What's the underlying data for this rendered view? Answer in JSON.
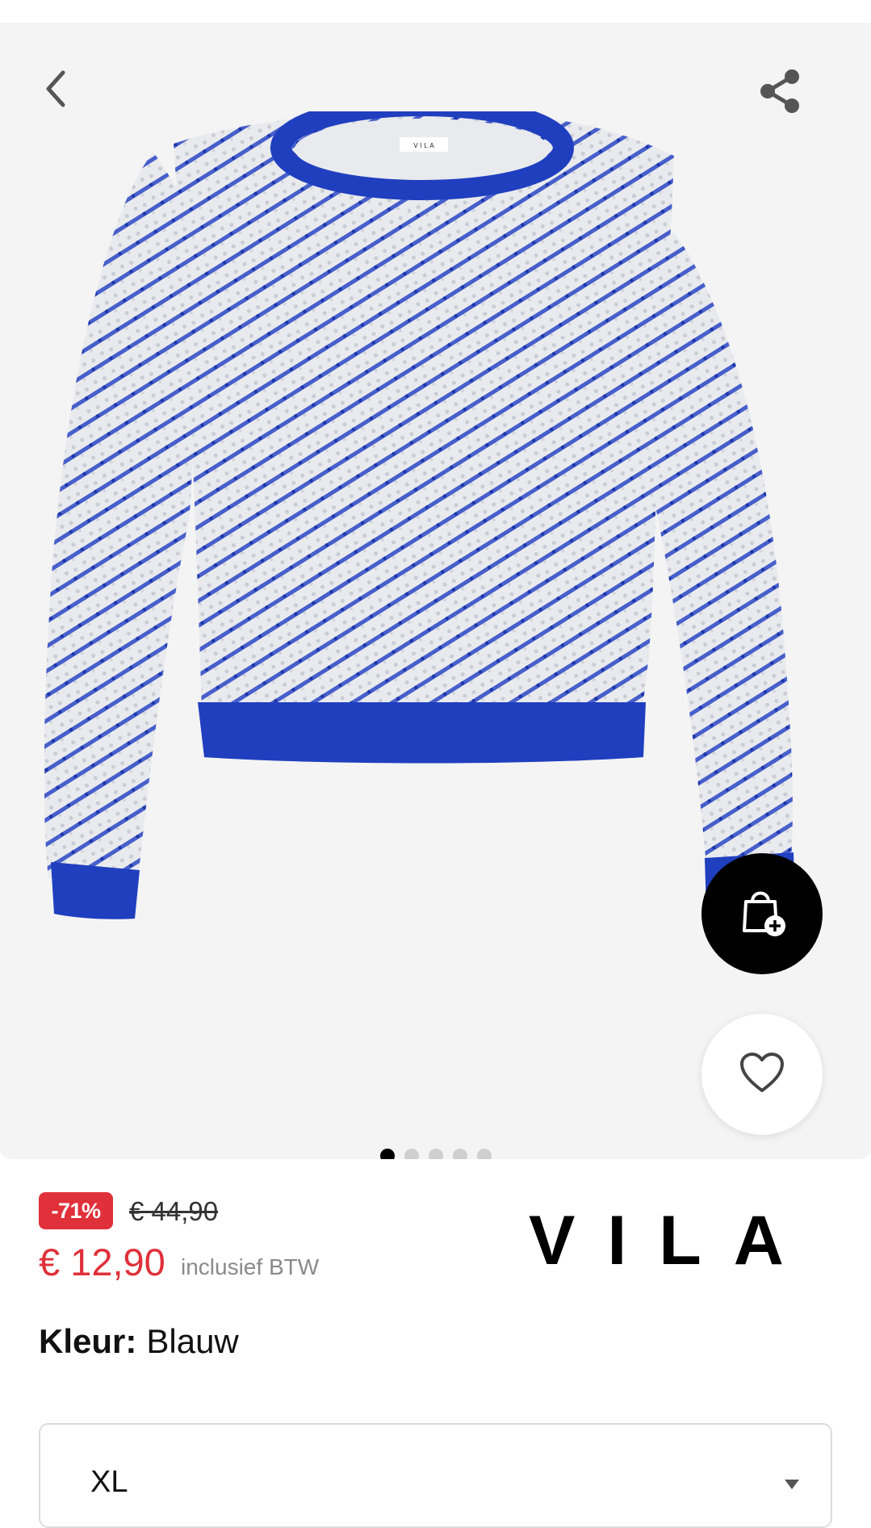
{
  "product": {
    "image_alt": "Blue and white knit sweater",
    "discount": "-71%",
    "old_price": "€ 44,90",
    "price": "€ 12,90",
    "vat_note": "inclusief BTW",
    "brand": "VILA",
    "color_label": "Kleur:",
    "color_value": "Blauw",
    "size_value": "XL"
  },
  "gallery": {
    "dot_count": 5,
    "active_dot": 1
  },
  "icons": {
    "back": "chevron-left-icon",
    "share": "share-icon",
    "bag": "bag-plus-icon",
    "favorite": "heart-icon",
    "dropdown": "triangle-down-icon"
  },
  "colors": {
    "sale_red": "#e0303a",
    "sweater_blue": "#1f3fbf",
    "gallery_bg": "#f4f4f4"
  }
}
